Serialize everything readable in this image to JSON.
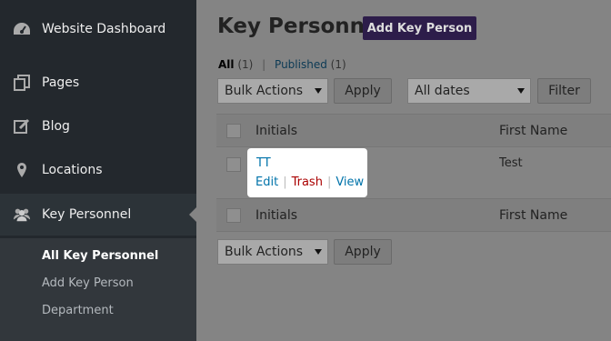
{
  "sidebar": {
    "items": [
      {
        "label": "Website Dashboard",
        "icon": "dashboard-icon"
      },
      {
        "label": "Pages",
        "icon": "pages-icon"
      },
      {
        "label": "Blog",
        "icon": "edit-icon"
      },
      {
        "label": "Locations",
        "icon": "location-pin-icon"
      },
      {
        "label": "Key Personnel",
        "icon": "people-icon"
      }
    ],
    "submenu": [
      {
        "label": "All Key Personnel"
      },
      {
        "label": "Add Key Person"
      },
      {
        "label": "Department"
      }
    ]
  },
  "header": {
    "title": "Key Personnel",
    "add_button": "Add Key Person"
  },
  "filters": {
    "all_label": "All",
    "all_count": "(1)",
    "separator": "|",
    "published_label": "Published",
    "published_count": "(1)"
  },
  "toolbar": {
    "bulk_actions": "Bulk Actions",
    "apply": "Apply",
    "all_dates": "All dates",
    "filter": "Filter"
  },
  "table": {
    "columns": [
      "Initials",
      "First Name"
    ],
    "rows": [
      {
        "initials": "TT",
        "first_name": "Test",
        "actions": {
          "edit": "Edit",
          "trash": "Trash",
          "view": "View",
          "sep": "|"
        }
      }
    ]
  },
  "colors": {
    "sidebar_bg": "#23282d",
    "accent": "#2d1d4a",
    "link": "#0073aa",
    "trash": "#aa0000"
  }
}
